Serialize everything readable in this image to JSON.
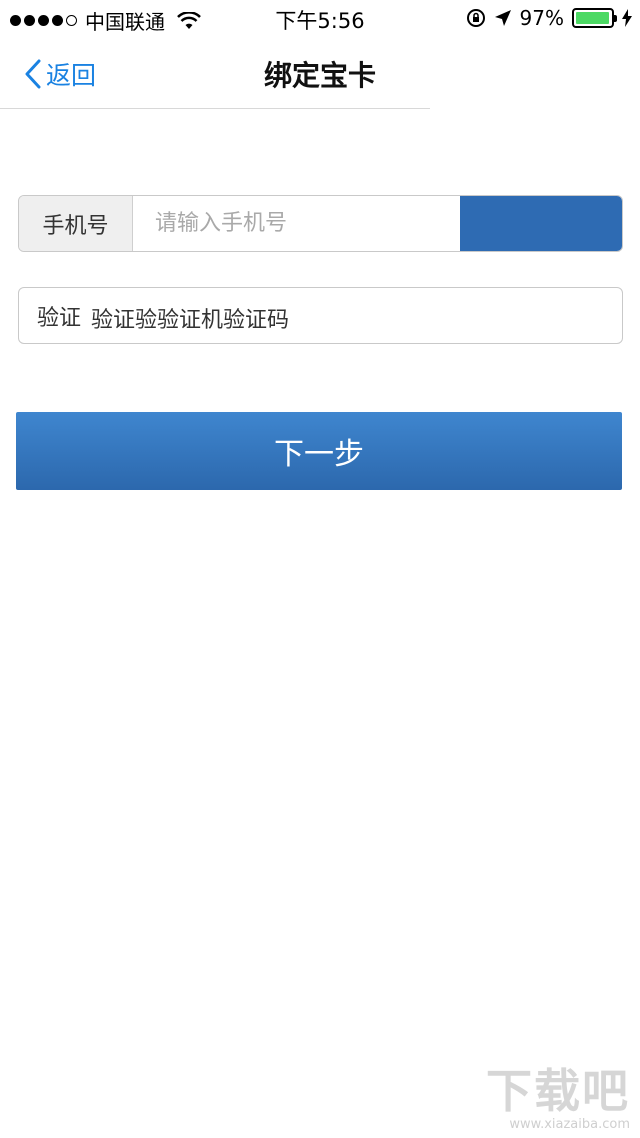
{
  "status_bar": {
    "carrier": "中国联通",
    "time": "下午5:56",
    "battery_percent": "97%",
    "signal_bars_filled": 4,
    "signal_bars_total": 5,
    "battery_level": 0.97,
    "battery_color": "#4cd964"
  },
  "nav": {
    "back_label": "返回",
    "title": "绑定宝卡",
    "accent_color": "#1a82e2"
  },
  "form": {
    "phone_label": "手机号",
    "phone_placeholder": "请输入手机号",
    "get_code_label": "",
    "code_label": "验证",
    "code_text": "验证验验证机验证码"
  },
  "next_button": {
    "label": "下一步",
    "color": "#2e6bb3"
  },
  "watermark": {
    "logo": "下载吧",
    "url": "www.xiazaiba.com"
  }
}
